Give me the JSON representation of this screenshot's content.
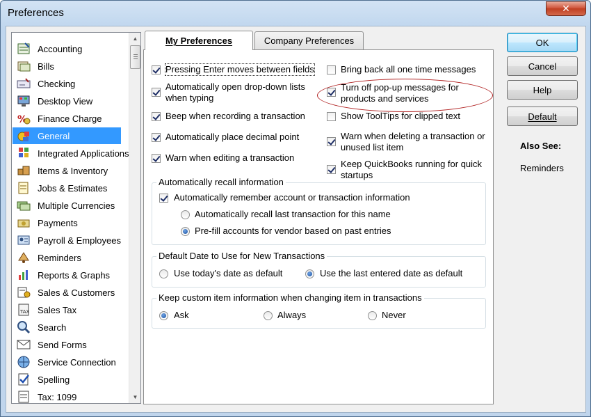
{
  "window": {
    "title": "Preferences",
    "close_glyph": "✕"
  },
  "categories": [
    {
      "label": "Accounting",
      "icon": "accounting-icon"
    },
    {
      "label": "Bills",
      "icon": "bills-icon"
    },
    {
      "label": "Checking",
      "icon": "checking-icon"
    },
    {
      "label": "Desktop View",
      "icon": "desktop-view-icon"
    },
    {
      "label": "Finance Charge",
      "icon": "finance-charge-icon"
    },
    {
      "label": "General",
      "icon": "general-icon",
      "selected": true
    },
    {
      "label": "Integrated Applications",
      "icon": "integrated-applications-icon"
    },
    {
      "label": "Items & Inventory",
      "icon": "items-inventory-icon"
    },
    {
      "label": "Jobs & Estimates",
      "icon": "jobs-estimates-icon"
    },
    {
      "label": "Multiple Currencies",
      "icon": "multiple-currencies-icon"
    },
    {
      "label": "Payments",
      "icon": "payments-icon"
    },
    {
      "label": "Payroll & Employees",
      "icon": "payroll-employees-icon"
    },
    {
      "label": "Reminders",
      "icon": "reminders-icon"
    },
    {
      "label": "Reports & Graphs",
      "icon": "reports-graphs-icon"
    },
    {
      "label": "Sales & Customers",
      "icon": "sales-customers-icon"
    },
    {
      "label": "Sales Tax",
      "icon": "sales-tax-icon"
    },
    {
      "label": "Search",
      "icon": "search-icon"
    },
    {
      "label": "Send Forms",
      "icon": "send-forms-icon"
    },
    {
      "label": "Service Connection",
      "icon": "service-connection-icon"
    },
    {
      "label": "Spelling",
      "icon": "spelling-icon"
    },
    {
      "label": "Tax: 1099",
      "icon": "tax-1099-icon"
    }
  ],
  "tabs": {
    "my": "My Preferences",
    "company": "Company Preferences"
  },
  "left_options": [
    {
      "label": "Pressing Enter moves between fields",
      "checked": true
    },
    {
      "label": "Automatically open drop-down lists",
      "label2": "when typing",
      "checked": true
    },
    {
      "label": "Beep when recording a transaction",
      "checked": true
    },
    {
      "label": "Automatically place decimal point",
      "checked": true
    },
    {
      "label": "Warn when editing a transaction",
      "checked": true
    }
  ],
  "right_options": [
    {
      "label": "Bring back all one time messages",
      "checked": false
    },
    {
      "label": "Turn off pop-up messages for",
      "label2": "products and services",
      "checked": true
    },
    {
      "label": "Show ToolTips for clipped text",
      "checked": false
    },
    {
      "label": "Warn when deleting a transaction or",
      "label2": "unused list item",
      "checked": true
    },
    {
      "label": "Keep QuickBooks running for quick",
      "label2": "startups",
      "checked": true
    }
  ],
  "recall": {
    "title": "Automatically recall information",
    "checkbox": "Automatically remember account or transaction information",
    "checkbox_checked": true,
    "radio1": "Automatically recall last transaction for this name",
    "radio2": "Pre-fill accounts for vendor based on past entries",
    "selected": 2
  },
  "default_date": {
    "title": "Default Date to Use for New Transactions",
    "radio1": "Use today's date as default",
    "radio2": "Use the last entered date as default",
    "selected": 2
  },
  "custom_item": {
    "title": "Keep custom item information when changing item in transactions",
    "options": [
      "Ask",
      "Always",
      "Never"
    ],
    "selected": 0
  },
  "buttons": {
    "ok": "OK",
    "cancel": "Cancel",
    "help": "Help",
    "default": "Default"
  },
  "also_see": {
    "heading": "Also See:",
    "link": "Reminders"
  },
  "colors": {
    "selection": "#3399ff",
    "highlight_oval": "#b02020"
  }
}
